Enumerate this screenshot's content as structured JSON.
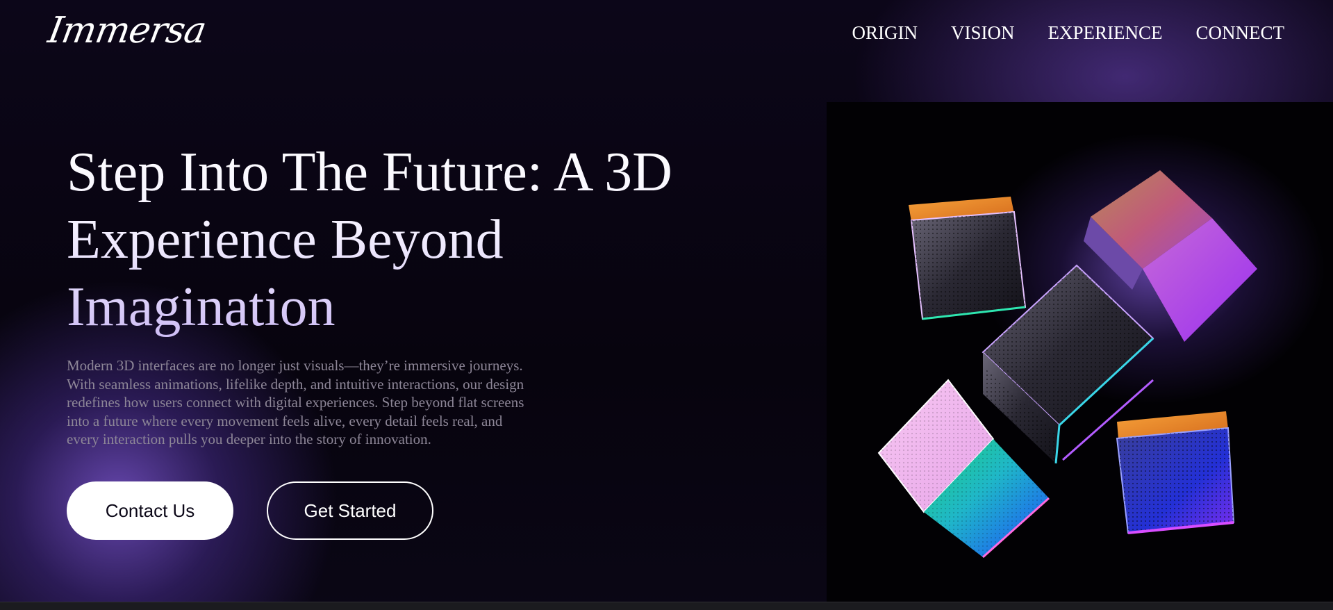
{
  "header": {
    "logo": "Immersa",
    "nav": [
      "ORIGIN",
      "VISION",
      "EXPERIENCE",
      "CONNECT"
    ]
  },
  "hero": {
    "title_lines": [
      "Step Into The Future: A 3D",
      "Experience Beyond",
      "Imagination"
    ],
    "description_lines": [
      "Modern 3D interfaces are no longer just visuals—they’re immersive journeys.",
      "With seamless animations, lifelike depth, and intuitive interactions, our design",
      "redefines how users connect with digital experiences. Step beyond flat screens",
      "into a future where every movement feels alive, every detail feels real, and",
      "every interaction pulls you deeper into the story of innovation."
    ],
    "buttons": {
      "contact": "Contact Us",
      "start": "Get Started"
    },
    "image": "iridescent-3d-cubes-illustration"
  },
  "colors": {
    "background": "#08040f",
    "accent_purple": "#7652c8",
    "body_text": "#8d8697",
    "button_fill": "#ffffff"
  }
}
